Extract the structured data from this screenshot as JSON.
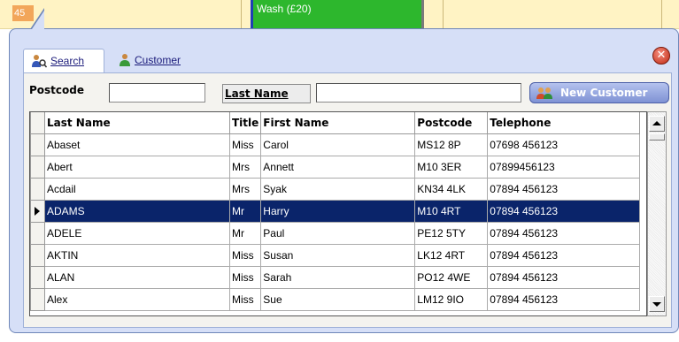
{
  "background": {
    "slot_number": "45",
    "appointment_label": "Wash (£20)",
    "appointment_color": "#2db72d",
    "calendar_color": "#fff3c4"
  },
  "tabs": [
    {
      "label": "Search",
      "icon": "users-search-icon",
      "active": true
    },
    {
      "label": "Customer",
      "icon": "user-icon",
      "active": false
    }
  ],
  "search": {
    "postcode_label": "Postcode",
    "postcode_value": "",
    "lastname_label": "Last Name",
    "lastname_value": "",
    "new_customer_label": "New Customer"
  },
  "grid": {
    "columns": [
      "Last Name",
      "Title",
      "First Name",
      "Postcode",
      "Telephone"
    ],
    "selected_index": 3,
    "selection_color": "#0a246a",
    "rows": [
      [
        "Abaset",
        "Miss",
        "Carol",
        "MS12 8P",
        "07698 456123"
      ],
      [
        "Abert",
        "Mrs",
        "Annett",
        "M10 3ER",
        "07899456123"
      ],
      [
        "Acdail",
        "Mrs",
        "Syak",
        "KN34 4LK",
        "07894 456123"
      ],
      [
        "ADAMS",
        "Mr",
        "Harry",
        "M10 4RT",
        "07894 456123"
      ],
      [
        "ADELE",
        "Mr",
        "Paul",
        "PE12 5TY",
        "07894 456123"
      ],
      [
        "AKTIN",
        "Miss",
        "Susan",
        "LK12 4RT",
        "07894 456123"
      ],
      [
        "ALAN",
        "Miss",
        "Sarah",
        "PO12 4WE",
        "07894 456123"
      ],
      [
        "Alex",
        "Miss",
        "Sue",
        "LM12 9IO",
        "07894 456123"
      ]
    ]
  }
}
